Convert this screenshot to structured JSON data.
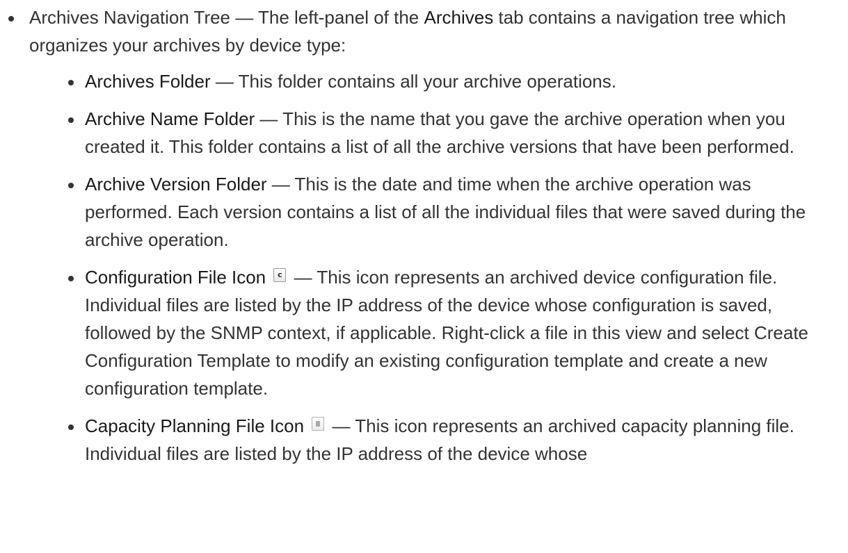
{
  "item": {
    "term": "Archives Navigation Tree",
    "text_a": " — The left-panel of the ",
    "strong": "Archives",
    "text_b": " tab contains a navigation tree which organizes your archives by device type:"
  },
  "subitems": [
    {
      "term": "Archives Folder",
      "desc": " — This folder contains all your archive operations."
    },
    {
      "term": "Archive Name Folder",
      "desc": " — This is the name that you gave the archive operation when you created it. This folder contains a list of all the archive versions that have been performed."
    },
    {
      "term": "Archive Version Folder",
      "desc": " — This is the date and time when the archive operation was performed. Each version contains a list of all the individual files that were saved during the archive operation."
    },
    {
      "term": "Configuration File Icon",
      "icon": "configuration-file-icon",
      "icon_glyph": "c",
      "desc": " — This icon represents an archived device configuration file. Individual files are listed by the IP address of the device whose configuration is saved, followed by the SNMP context, if applicable. Right-click a file in this view and select Create Configuration Template to modify an existing configuration template and create a new configuration template."
    },
    {
      "term": "Capacity Planning File Icon",
      "icon": "capacity-planning-file-icon",
      "desc": " — This icon represents an archived capacity planning file. Individual files are listed by the IP address of the device whose"
    }
  ]
}
